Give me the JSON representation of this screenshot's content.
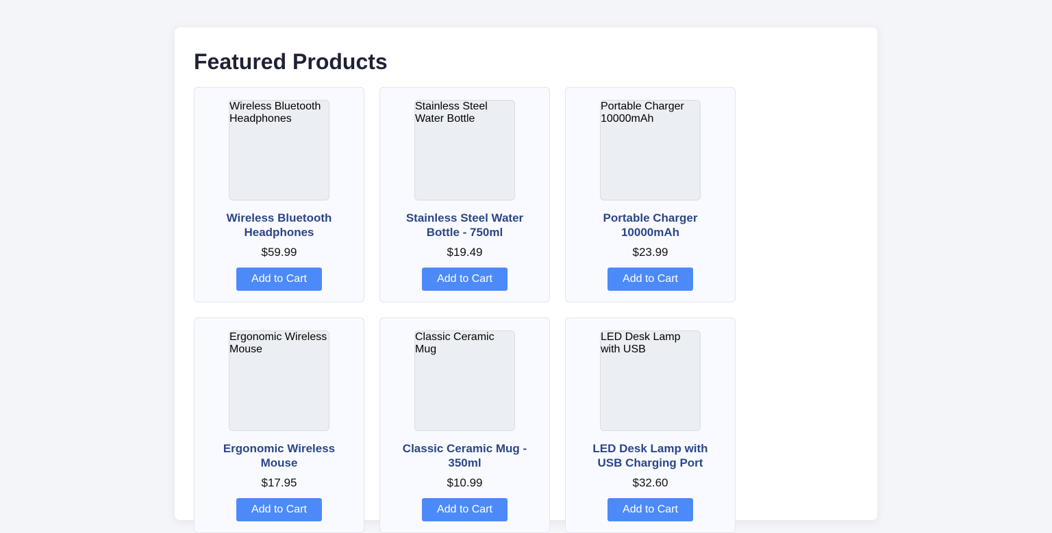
{
  "page": {
    "title": "Featured Products"
  },
  "products": [
    {
      "image_alt": "Wireless Bluetooth Headphones",
      "name": "Wireless Bluetooth Headphones",
      "price": "$59.99",
      "button_label": "Add to Cart"
    },
    {
      "image_alt": "Stainless Steel Water Bottle",
      "name": "Stainless Steel Water Bottle - 750ml",
      "price": "$19.49",
      "button_label": "Add to Cart"
    },
    {
      "image_alt": "Portable Charger 10000mAh",
      "name": "Portable Charger 10000mAh",
      "price": "$23.99",
      "button_label": "Add to Cart"
    },
    {
      "image_alt": "Ergonomic Wireless Mouse",
      "name": "Ergonomic Wireless Mouse",
      "price": "$17.95",
      "button_label": "Add to Cart"
    },
    {
      "image_alt": "Classic Ceramic Mug",
      "name": "Classic Ceramic Mug - 350ml",
      "price": "$10.99",
      "button_label": "Add to Cart"
    },
    {
      "image_alt": "LED Desk Lamp with USB",
      "name": "LED Desk Lamp with USB Charging Port",
      "price": "$32.60",
      "button_label": "Add to Cart"
    }
  ],
  "colors": {
    "accent": "#4d8af9",
    "product_name": "#2b4687",
    "title": "#1f2235",
    "background": "#f4f5f9"
  }
}
